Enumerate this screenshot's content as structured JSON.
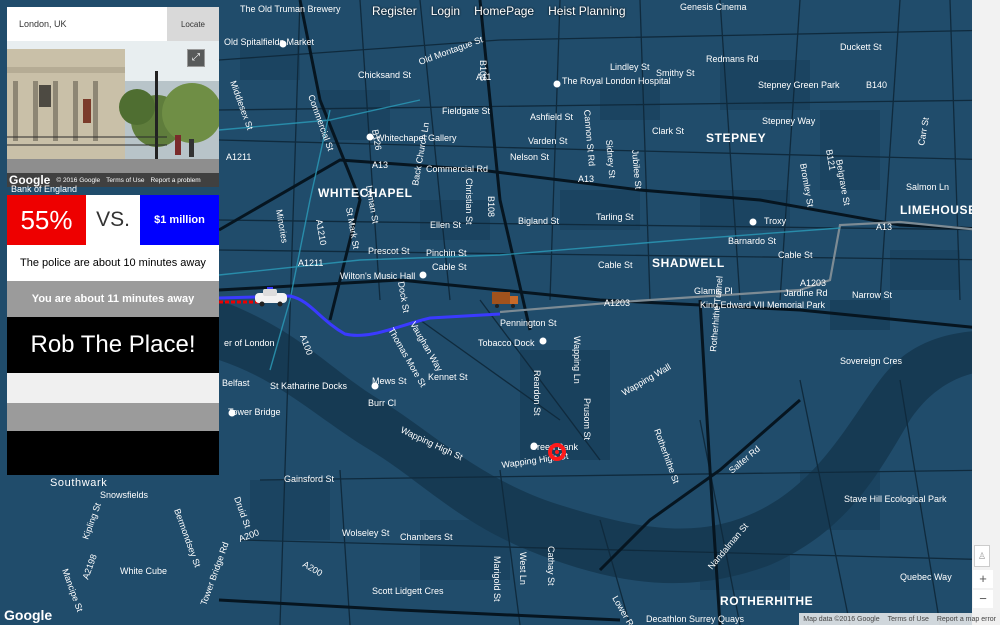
{
  "nav": {
    "register": "Register",
    "login": "Login",
    "homepage": "HomePage",
    "heist_planning": "Heist Planning"
  },
  "search": {
    "value": "London, UK",
    "button": "Locate"
  },
  "streetview": {
    "copyright": "© 2016 Google",
    "terms": "Terms of Use",
    "report": "Report a problem",
    "logo": "Google",
    "caption": "Bank of England"
  },
  "stats": {
    "percent": "55%",
    "vs": "VS.",
    "prize": "$1 million",
    "police": "The police are about 10 minutes away",
    "you": "You are about 11 minutes away",
    "rob_button": "Rob The Place!"
  },
  "map": {
    "areas": {
      "whitechapel": "WHITECHAPEL",
      "stepney": "STEPNEY",
      "limehouse": "LIMEHOUSE",
      "shadwell": "SHADWELL",
      "rotherhithe": "ROTHERHITHE",
      "southwark": "Southwark"
    },
    "streets": {
      "truman": "The Old Truman Brewery",
      "genesis": "Genesis Cinema",
      "spitalfields": "Old Spitalfields Market",
      "chicksand": "Chicksand St",
      "old_montague": "Old Montague St",
      "royal_london": "The Royal London Hospital",
      "lindley": "Lindley St",
      "smithy": "Smithy St",
      "redmans": "Redmans Rd",
      "stepney_green_park": "Stepney Green Park",
      "duckett": "Duckett St",
      "middlesex": "Middlesex St",
      "commercial_st": "Commercial St",
      "fieldgate": "Fieldgate St",
      "ashfield": "Ashfield St",
      "whitechapel_gallery": "Whitechapel Gallery",
      "varden": "Varden St",
      "nelson": "Nelson St",
      "clark": "Clark St",
      "stepney_way": "Stepney Way",
      "commercial_rd": "Commercial Rd",
      "salmon": "Salmon Ln",
      "christian": "Christian St",
      "bigland": "Bigland St",
      "tarling": "Tarling St",
      "troxy": "Troxy",
      "barnardo": "Barnardo St",
      "pinchin": "Pinchin St",
      "ellen": "Ellen St",
      "prescot": "Prescot St",
      "wiltons": "Wilton's Music Hall",
      "cable": "Cable St",
      "glamis": "Glamis Pl",
      "jardine": "Jardine Rd",
      "narrow": "Narrow St",
      "pennington": "Pennington St",
      "king_edward": "King Edward VII Memorial Park",
      "tobacco_dock": "Tobacco Dock",
      "tower_of_london": "er of London",
      "st_katharine": "St Katharine Docks",
      "belfast": "Belfast",
      "tower_bridge": "Tower Bridge",
      "wapping_high": "Wapping High St",
      "wapping_ln": "Wapping Ln",
      "wapping_wall": "Wapping Wall",
      "kennet": "Kennet St",
      "mews": "Mews St",
      "burr": "Burr Cl",
      "thomas_more": "Thomas More St",
      "vaughan": "Vaughan Way",
      "dock_st": "Dock St",
      "prusom": "Prusom St",
      "reardon": "Reardon St",
      "rotherhithe_st": "Rotherhithe St",
      "rotherhithe_tunnel": "Rotherhithe Tunnel",
      "sovereign": "Sovereign Cres",
      "salter": "Salter Rd",
      "stave_hill": "Stave Hill Ecological Park",
      "snowsfields": "Snowsfields",
      "bermondsey": "Bermondsey St",
      "white_cube": "White Cube",
      "druid": "Druid St",
      "wolseley": "Wolseley St",
      "chambers": "Chambers St",
      "scott_lidgett": "Scott Lidgett Cres",
      "gainsford": "Gainsford St",
      "decathlon": "Decathlon Surrey Quays",
      "quebec": "Quebec Way",
      "lower_rd": "Lower Rd",
      "cathay": "Cathay St",
      "west_ln": "West Ln",
      "marigold": "Marigold St",
      "mancipe": "Mancipe St",
      "kipling": "Kipling St",
      "tower_bridge_rd": "Tower Bridge Rd",
      "lamb": "Lamb St",
      "minories": "Minories",
      "leman": "Leman St",
      "mark": "St Mark St",
      "back_church": "Back Church Ln",
      "cannon": "Cannon St Rd",
      "sidney": "Sidney St",
      "jubilee": "Jubilee St",
      "bromley": "Bromley St",
      "belgrave": "Belgrave St",
      "carr": "Carr St",
      "nandalman": "Nandalman St",
      "green_bank": "Green Bank"
    },
    "roads": {
      "a13a": "A13",
      "a13b": "A13",
      "a11": "A11",
      "a1211": "A1211",
      "a1210": "A1210",
      "a1211b": "A1211",
      "a1203": "A1203",
      "a1203b": "A1203",
      "a100": "A100",
      "a200": "A200",
      "a200b": "A200",
      "a2198": "A2198",
      "b108": "B108",
      "b108b": "B108",
      "b126": "B126",
      "b140": "B140",
      "b121": "B121",
      "a13c": "A13"
    },
    "logo": "Google",
    "attribution": {
      "data": "Map data ©2016 Google",
      "terms": "Terms of Use",
      "report": "Report a map error"
    }
  },
  "colors": {
    "water": "#163c56",
    "land": "#1f4a68",
    "road_major": "#0a1d2c",
    "police_red": "#ee0000",
    "prize_blue": "#0000ff",
    "route": "#3a3aff"
  },
  "icons": [
    "police-car-icon",
    "truck-icon",
    "target-marker-icon",
    "expand-icon",
    "pegman-icon"
  ]
}
